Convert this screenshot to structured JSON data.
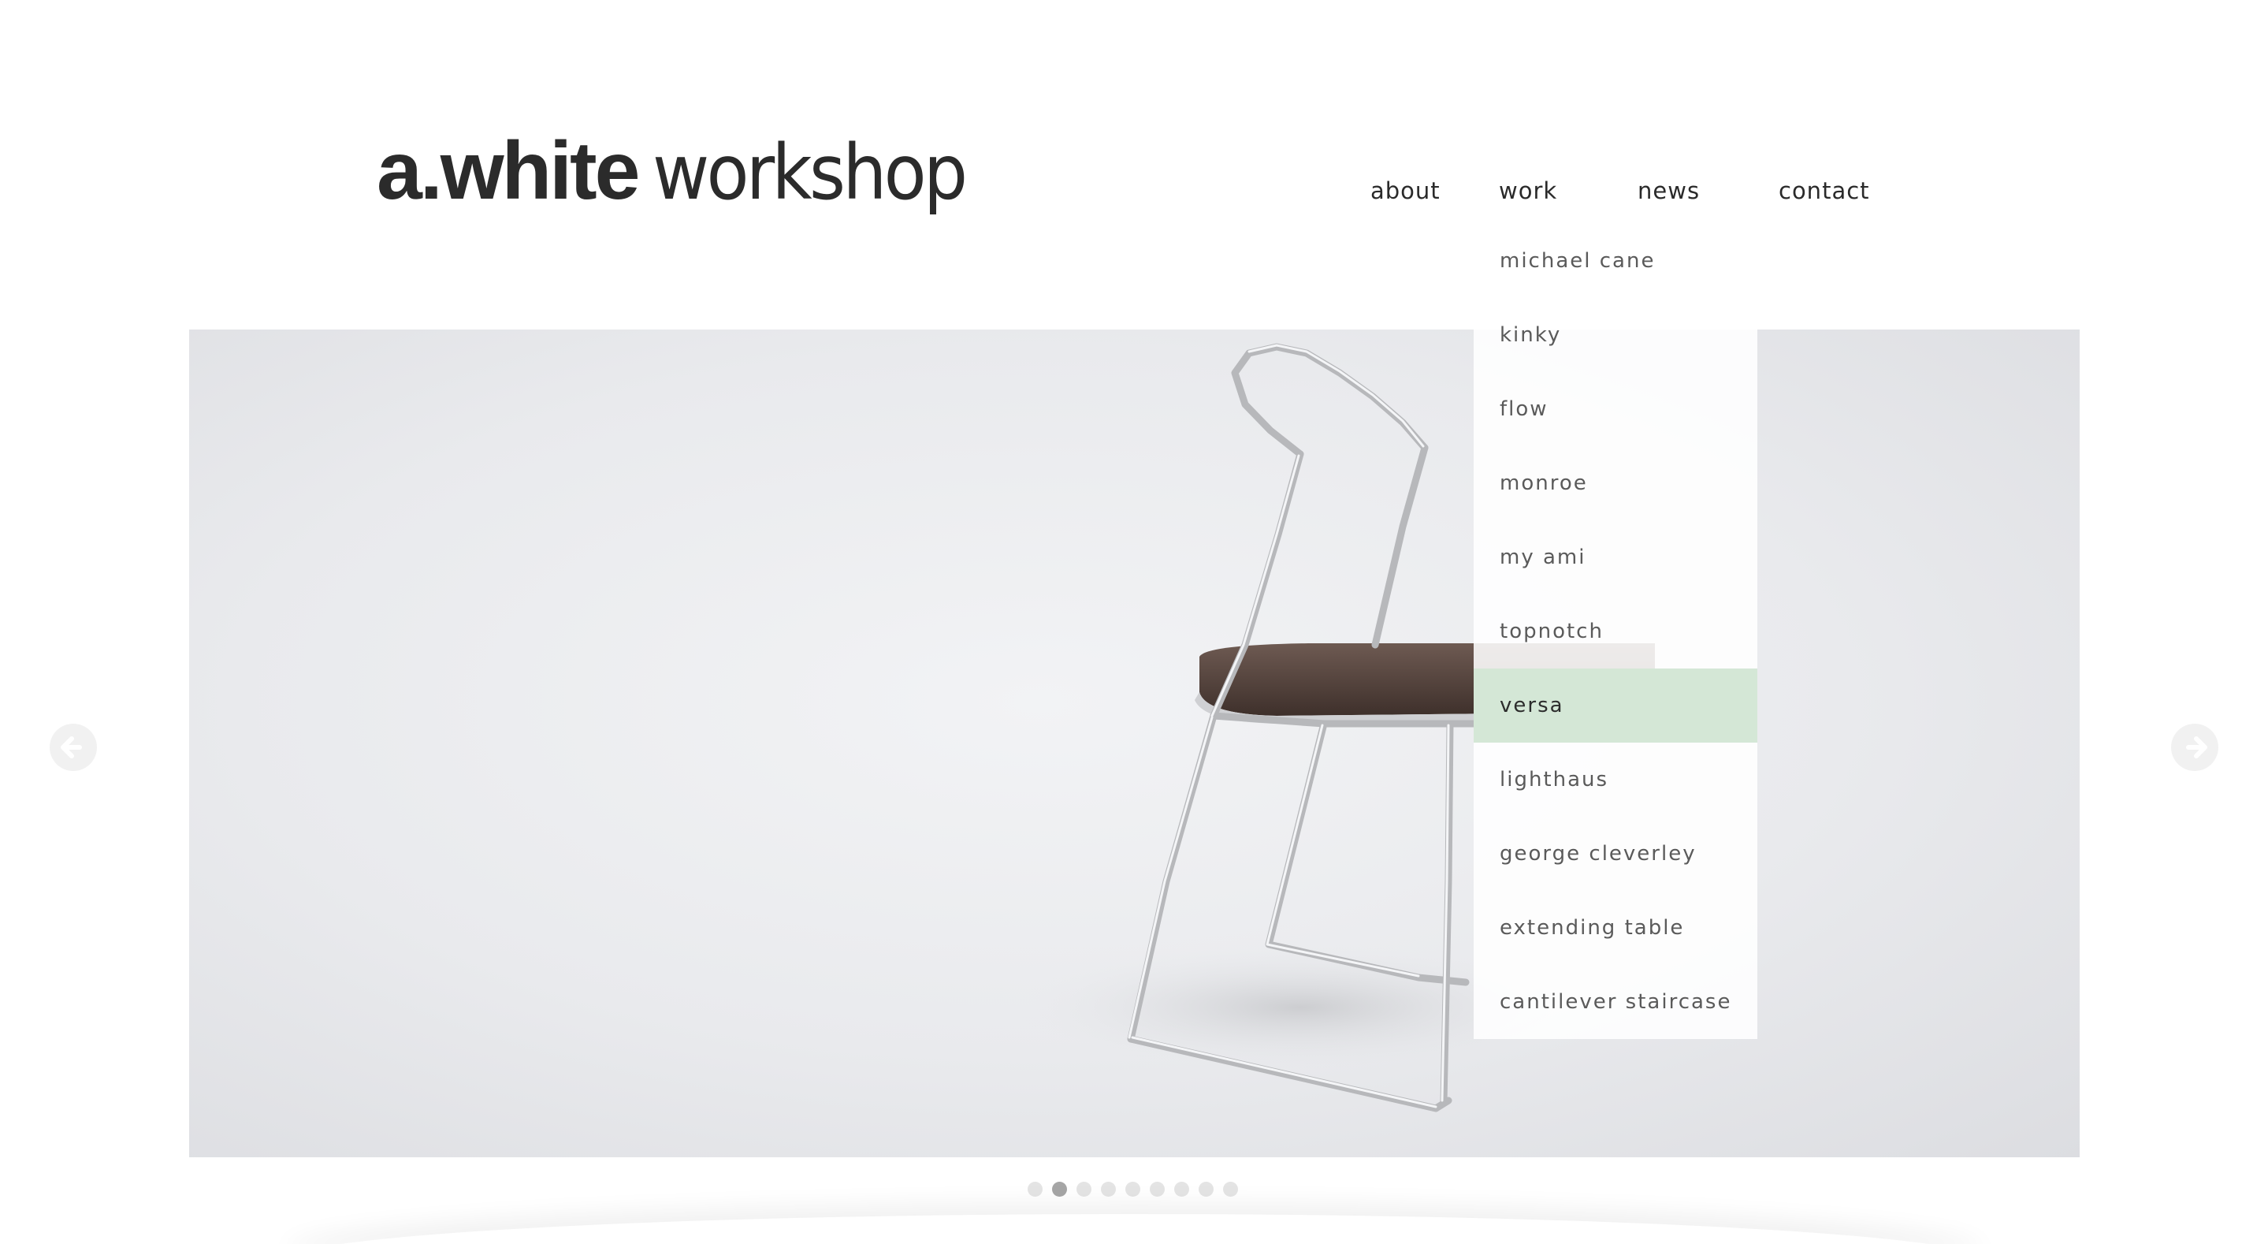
{
  "logo": {
    "bold": "a.white",
    "light": "workshop"
  },
  "nav": {
    "items": [
      "about",
      "work",
      "news",
      "contact"
    ]
  },
  "work_menu": {
    "items": [
      "michael cane",
      "kinky",
      "flow",
      "monroe",
      "my ami",
      "topnotch",
      "versa",
      "lighthaus",
      "george cleverley",
      "extending table",
      "cantilever staircase"
    ],
    "active": "versa"
  },
  "slider": {
    "slide_count": 9,
    "active_slide": 2,
    "prev_icon": "arrow-left-icon",
    "next_icon": "arrow-right-icon"
  },
  "colors": {
    "active_highlight": "#d4e7d6",
    "text": "#2a2a2a",
    "menu_text": "#5a5a5a"
  }
}
